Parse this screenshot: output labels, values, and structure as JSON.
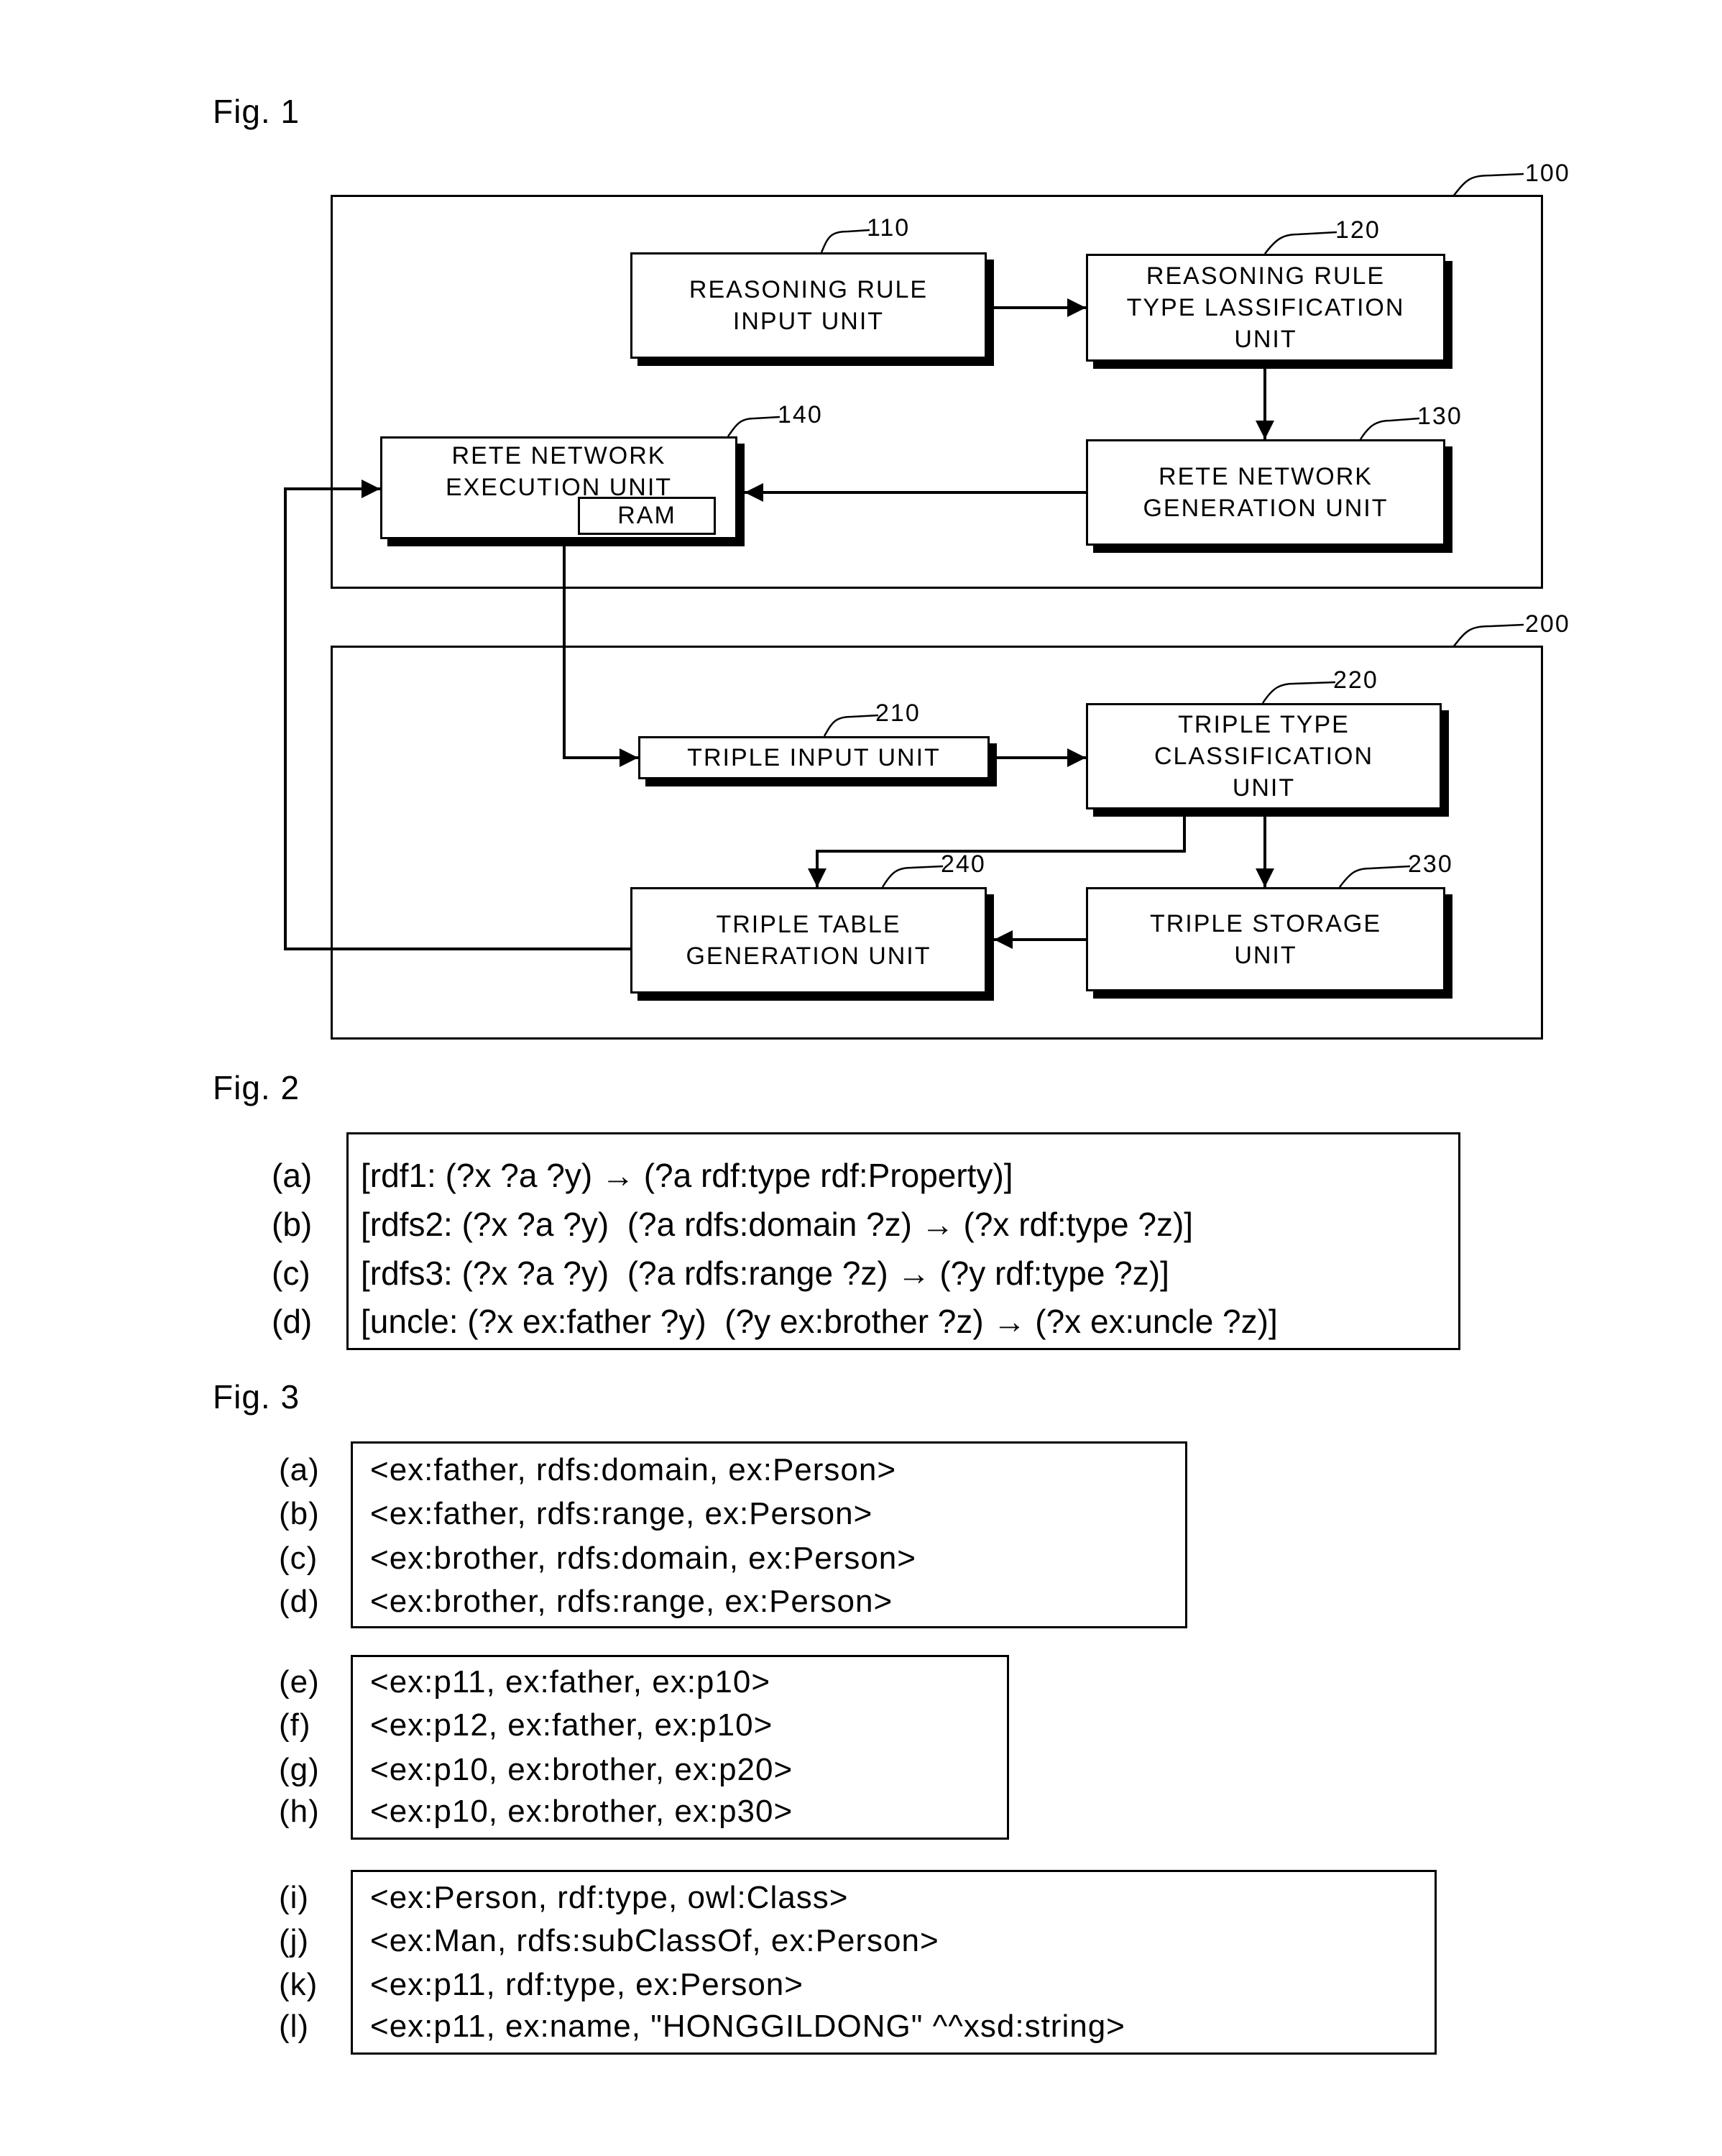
{
  "fig1": {
    "label": "Fig. 1",
    "groups": [
      {
        "ref": "100"
      },
      {
        "ref": "200"
      }
    ],
    "units": [
      {
        "id": "110",
        "ref": "110",
        "text": "REASONING RULE\nINPUT UNIT"
      },
      {
        "id": "120",
        "ref": "120",
        "text": "REASONING RULE\nTYPE LASSIFICATION\nUNIT"
      },
      {
        "id": "130",
        "ref": "130",
        "text": "RETE NETWORK\nGENERATION UNIT"
      },
      {
        "id": "140",
        "ref": "140",
        "text": "RETE NETWORK\nEXECUTION UNIT",
        "sub": "RAM"
      },
      {
        "id": "210",
        "ref": "210",
        "text": "TRIPLE INPUT UNIT"
      },
      {
        "id": "220",
        "ref": "220",
        "text": "TRIPLE TYPE\nCLASSIFICATION\nUNIT"
      },
      {
        "id": "230",
        "ref": "230",
        "text": "TRIPLE STORAGE\nUNIT"
      },
      {
        "id": "240",
        "ref": "240",
        "text": "TRIPLE TABLE\nGENERATION UNIT"
      }
    ],
    "connections": [
      {
        "from": "110",
        "to": "120"
      },
      {
        "from": "120",
        "to": "130"
      },
      {
        "from": "130",
        "to": "140"
      },
      {
        "from": "140",
        "to": "210"
      },
      {
        "from": "210",
        "to": "220"
      },
      {
        "from": "220",
        "to": "230"
      },
      {
        "from": "220",
        "to": "240"
      },
      {
        "from": "230",
        "to": "240"
      },
      {
        "from": "240",
        "to": "140"
      }
    ]
  },
  "fig2": {
    "label": "Fig. 2",
    "rules": [
      {
        "tag": "(a)",
        "text": "[rdf1: (?x ?a ?y) → (?a rdf:type rdf:Property)]"
      },
      {
        "tag": "(b)",
        "text": "[rdfs2: (?x ?a ?y)  (?a rdfs:domain ?z) → (?x rdf:type ?z)]"
      },
      {
        "tag": "(c)",
        "text": "[rdfs3: (?x ?a ?y)  (?a rdfs:range ?z) → (?y rdf:type ?z)]"
      },
      {
        "tag": "(d)",
        "text": "[uncle: (?x ex:father ?y)  (?y ex:brother ?z) → (?x ex:uncle ?z)]"
      }
    ]
  },
  "fig3": {
    "label": "Fig. 3",
    "groups": [
      [
        {
          "tag": "(a)",
          "text": "<ex:father, rdfs:domain, ex:Person>"
        },
        {
          "tag": "(b)",
          "text": "<ex:father, rdfs:range, ex:Person>"
        },
        {
          "tag": "(c)",
          "text": "<ex:brother, rdfs:domain, ex:Person>"
        },
        {
          "tag": "(d)",
          "text": "<ex:brother, rdfs:range, ex:Person>"
        }
      ],
      [
        {
          "tag": "(e)",
          "text": "<ex:p11, ex:father, ex:p10>"
        },
        {
          "tag": "(f)",
          "text": "<ex:p12, ex:father, ex:p10>"
        },
        {
          "tag": "(g)",
          "text": "<ex:p10, ex:brother, ex:p20>"
        },
        {
          "tag": "(h)",
          "text": "<ex:p10, ex:brother, ex:p30>"
        }
      ],
      [
        {
          "tag": "(i)",
          "text": "<ex:Person, rdf:type, owl:Class>"
        },
        {
          "tag": "(j)",
          "text": "<ex:Man, rdfs:subClassOf, ex:Person>"
        },
        {
          "tag": "(k)",
          "text": "<ex:p11, rdf:type, ex:Person>"
        },
        {
          "tag": "(l)",
          "text": "<ex:p11, ex:name, \"HONGGILDONG\" ^^xsd:string>"
        }
      ]
    ]
  }
}
